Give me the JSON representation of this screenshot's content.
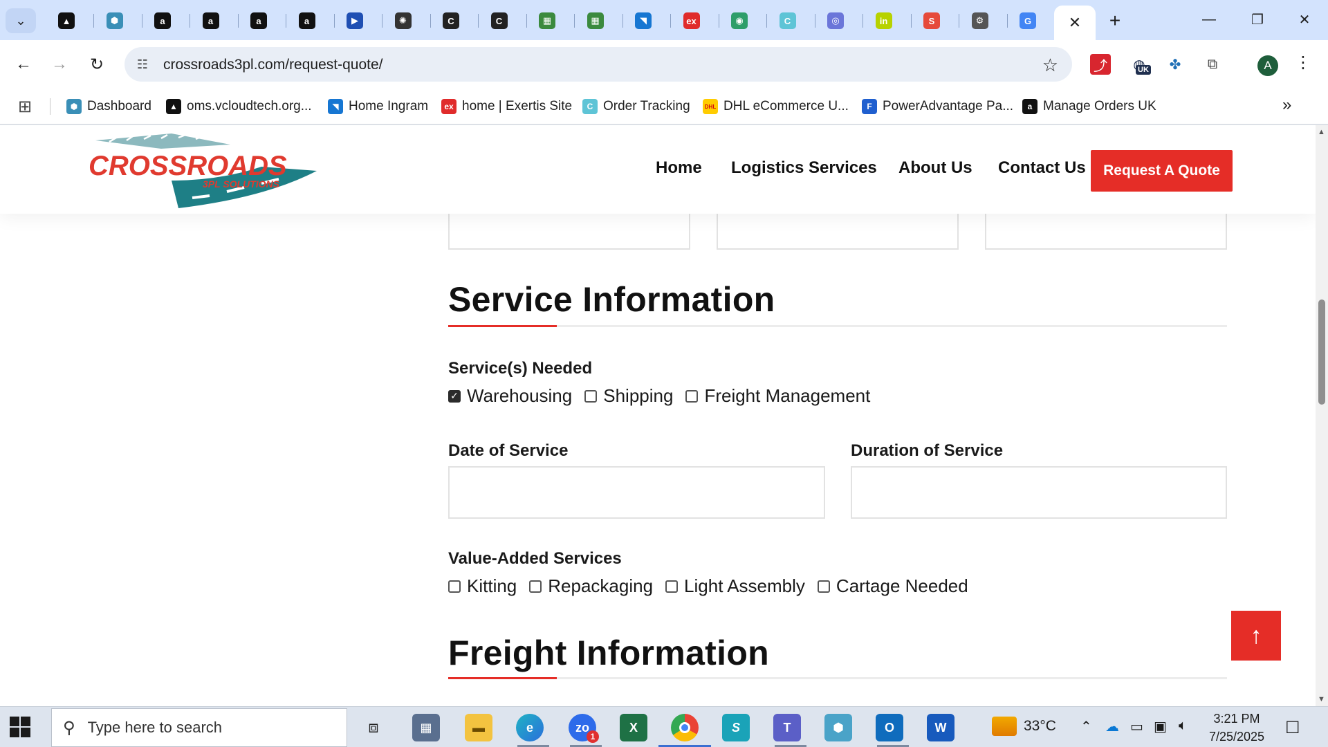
{
  "browser": {
    "tabs": [
      {
        "icon": "vcloud-icon",
        "glyph": "▲",
        "color": "#111111"
      },
      {
        "icon": "hex-icon",
        "glyph": "⬢",
        "color": "#3a8fb7"
      },
      {
        "icon": "amazon-icon",
        "glyph": "a",
        "color": "#111111"
      },
      {
        "icon": "amazon-icon",
        "glyph": "a",
        "color": "#111111"
      },
      {
        "icon": "amazon-icon",
        "glyph": "a",
        "color": "#111111"
      },
      {
        "icon": "amazon-icon",
        "glyph": "a",
        "color": "#111111"
      },
      {
        "icon": "play-icon",
        "glyph": "▶",
        "color": "#1f4fb3"
      },
      {
        "icon": "openai-icon",
        "glyph": "✺",
        "color": "#333333"
      },
      {
        "icon": "c-icon",
        "glyph": "C",
        "color": "#222222"
      },
      {
        "icon": "c-icon",
        "glyph": "C",
        "color": "#222222"
      },
      {
        "icon": "sheet-icon",
        "glyph": "▦",
        "color": "#3b8a3e"
      },
      {
        "icon": "sheet-icon",
        "glyph": "▦",
        "color": "#3b8a3e"
      },
      {
        "icon": "ingram-icon",
        "glyph": "◥",
        "color": "#1676d2"
      },
      {
        "icon": "exertis-icon",
        "glyph": "ex",
        "color": "#e02b2b"
      },
      {
        "icon": "green-circle-icon",
        "glyph": "◉",
        "color": "#2e9e6a"
      },
      {
        "icon": "order-tracking-icon",
        "glyph": "C",
        "color": "#5ec4d6"
      },
      {
        "icon": "stripes-icon",
        "glyph": "◎",
        "color": "#6b76d9"
      },
      {
        "icon": "infos-icon",
        "glyph": "in",
        "color": "#b7d200"
      },
      {
        "icon": "shree-icon",
        "glyph": "S",
        "color": "#e64a3b"
      },
      {
        "icon": "chrome-settings-icon",
        "glyph": "⚙",
        "color": "#555555"
      },
      {
        "icon": "google-icon",
        "glyph": "G",
        "color": "#4285f4"
      }
    ],
    "active_tab_close": "✕",
    "new_tab": "+",
    "url": "crossroads3pl.com/request-quote/",
    "profile_initial": "A",
    "extension_badge": "UK",
    "bookmarks": [
      {
        "label": "Dashboard",
        "icon": "hex-icon",
        "glyph": "⬢",
        "color": "#3a8fb7"
      },
      {
        "label": "oms.vcloudtech.org...",
        "icon": "vcloud-icon",
        "glyph": "▲",
        "color": "#111111"
      },
      {
        "label": "Home Ingram",
        "icon": "ingram-icon",
        "glyph": "◥",
        "color": "#1676d2"
      },
      {
        "label": "home | Exertis Site",
        "icon": "exertis-icon",
        "glyph": "ex",
        "color": "#e02b2b"
      },
      {
        "label": "Order Tracking",
        "icon": "order-tracking-icon",
        "glyph": "C",
        "color": "#5ec4d6"
      },
      {
        "label": "DHL eCommerce U...",
        "icon": "dhl-icon",
        "glyph": "DHL",
        "color": "#ffcc00"
      },
      {
        "label": "PowerAdvantage Pa...",
        "icon": "poweradvantage-icon",
        "glyph": "F",
        "color": "#1f5fcf"
      },
      {
        "label": "Manage Orders UK",
        "icon": "amazon-icon",
        "glyph": "a",
        "color": "#111111"
      }
    ]
  },
  "site": {
    "logo_text": "CROSSROADS",
    "logo_subtext": "3PL SOLUTIONS",
    "nav": [
      "Home",
      "Logistics Services",
      "About Us",
      "Contact Us"
    ],
    "cta": "Request A Quote",
    "colors": {
      "accent": "#e52d27",
      "logo_teal": "#2a8a8f"
    }
  },
  "form": {
    "service_section_title": "Service Information",
    "services_needed_label": "Service(s) Needed",
    "services": [
      {
        "label": "Warehousing",
        "checked": true
      },
      {
        "label": "Shipping",
        "checked": false
      },
      {
        "label": "Freight Management",
        "checked": false
      }
    ],
    "date_label": "Date of Service",
    "date_value": "",
    "duration_label": "Duration of Service",
    "duration_value": "",
    "value_added_label": "Value-Added Services",
    "value_added": [
      {
        "label": "Kitting",
        "checked": false
      },
      {
        "label": "Repackaging",
        "checked": false
      },
      {
        "label": "Light Assembly",
        "checked": false
      },
      {
        "label": "Cartage Needed",
        "checked": false
      }
    ],
    "freight_section_title": "Freight Information"
  },
  "taskbar": {
    "search_placeholder": "Type here to search",
    "weather": "33°C",
    "time": "3:21 PM",
    "date": "7/25/2025",
    "zoom_badge": "1"
  }
}
